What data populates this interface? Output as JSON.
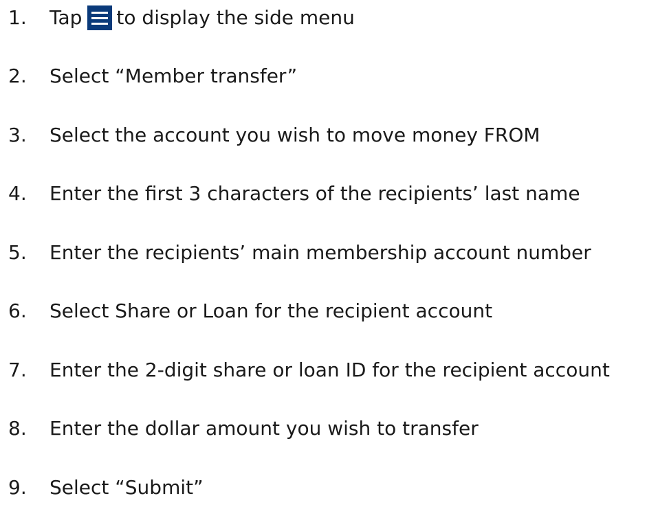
{
  "steps": [
    {
      "number": "1.",
      "before_icon": "Tap",
      "icon": "hamburger-menu-icon",
      "after_icon": "to display the side menu"
    },
    {
      "number": "2.",
      "text": "Select “Member transfer”"
    },
    {
      "number": "3.",
      "text": "Select the account you wish to move money FROM"
    },
    {
      "number": "4.",
      "text": "Enter the first 3 characters of the recipients’ last name"
    },
    {
      "number": "5.",
      "text": "Enter the recipients’ main membership account number"
    },
    {
      "number": "6.",
      "text": "Select Share or Loan for the recipient account"
    },
    {
      "number": "7.",
      "text": "Enter the 2-digit share or loan ID for the recipient account"
    },
    {
      "number": "8.",
      "text": "Enter the dollar amount you wish to transfer"
    },
    {
      "number": "9.",
      "text": "Select “Submit”"
    }
  ],
  "colors": {
    "icon_background": "#0a3a7a",
    "icon_lines": "#ffffff",
    "text": "#1a1a1a"
  }
}
